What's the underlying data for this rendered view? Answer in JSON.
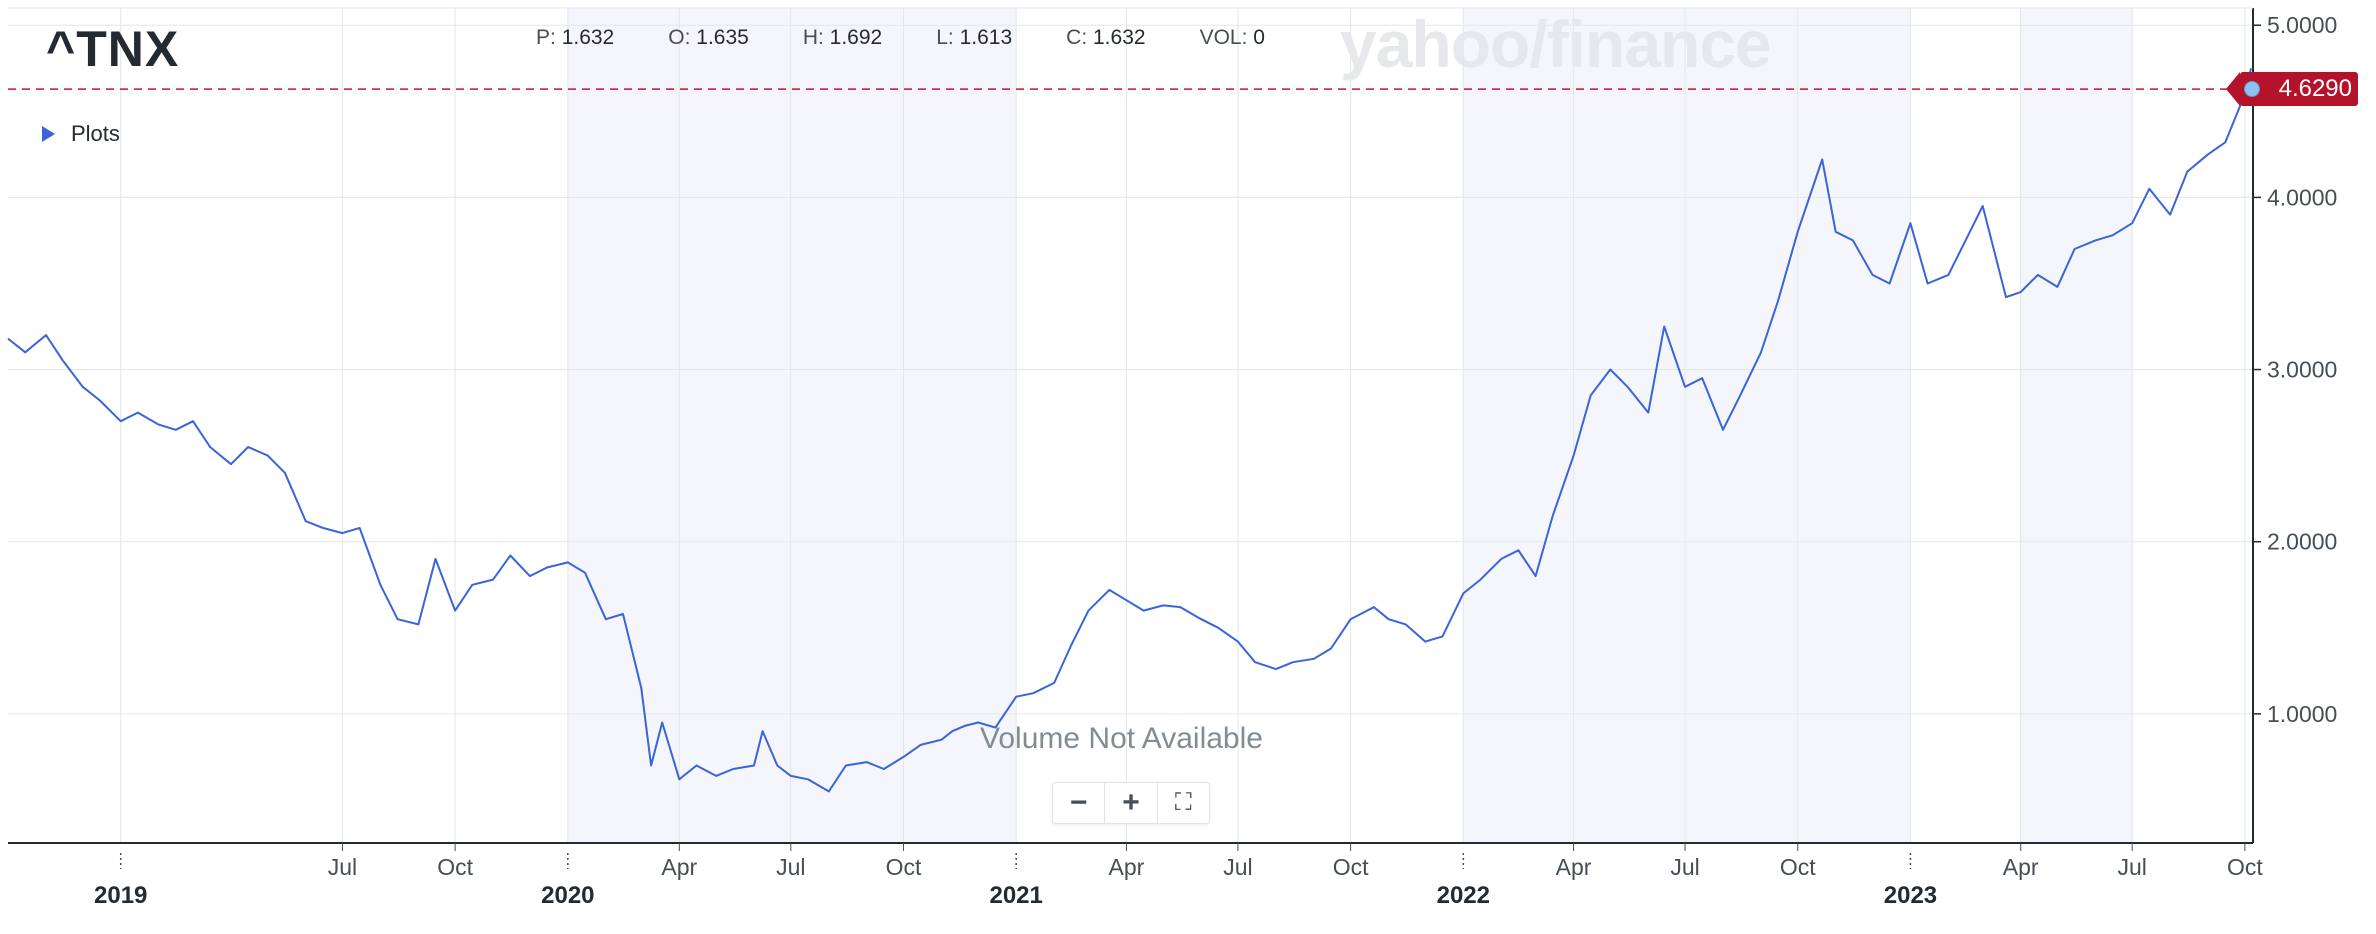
{
  "header": {
    "ticker": "^TNX",
    "ohlc": [
      {
        "key": "P:",
        "value": "1.632"
      },
      {
        "key": "O:",
        "value": "1.635"
      },
      {
        "key": "H:",
        "value": "1.692"
      },
      {
        "key": "L:",
        "value": "1.613"
      },
      {
        "key": "C:",
        "value": "1.632"
      },
      {
        "key": "VOL:",
        "value": "0"
      }
    ],
    "watermark": "yahoo/finance"
  },
  "plots_label": "Plots",
  "volume_note": "Volume Not Available",
  "zoom": {
    "minus": "−",
    "plus": "+",
    "fullscreen": "⛶"
  },
  "current_price": "4.6290",
  "colors": {
    "line": "#3a64d8",
    "price_tag": "#b4122a",
    "shade": "#f4f6fb",
    "grid": "#e3e6ea"
  },
  "chart_data": {
    "type": "line",
    "series": [
      {
        "x": [
          "2018-10-01",
          "2018-10-15",
          "2018-11-01",
          "2018-11-15",
          "2018-12-01",
          "2018-12-15",
          "2019-01-01",
          "2019-01-15",
          "2019-02-01",
          "2019-02-15",
          "2019-03-01",
          "2019-03-15",
          "2019-04-01",
          "2019-04-15",
          "2019-05-01",
          "2019-05-15",
          "2019-06-01",
          "2019-06-15",
          "2019-07-01",
          "2019-07-15",
          "2019-08-01",
          "2019-08-15",
          "2019-09-01",
          "2019-09-15",
          "2019-10-01",
          "2019-10-15",
          "2019-11-01",
          "2019-11-15",
          "2019-12-01",
          "2019-12-15",
          "2020-01-01",
          "2020-01-15",
          "2020-02-01",
          "2020-02-15",
          "2020-03-01",
          "2020-03-09",
          "2020-03-18",
          "2020-04-01",
          "2020-04-15",
          "2020-05-01",
          "2020-05-15",
          "2020-06-01",
          "2020-06-08",
          "2020-06-20",
          "2020-07-01",
          "2020-07-15",
          "2020-08-01",
          "2020-08-15",
          "2020-09-01",
          "2020-09-15",
          "2020-10-01",
          "2020-10-15",
          "2020-11-01",
          "2020-11-10",
          "2020-11-20",
          "2020-12-01",
          "2020-12-15",
          "2021-01-01",
          "2021-01-15",
          "2021-02-01",
          "2021-02-15",
          "2021-03-01",
          "2021-03-18",
          "2021-04-01",
          "2021-04-15",
          "2021-05-01",
          "2021-05-15",
          "2021-06-01",
          "2021-06-15",
          "2021-07-01",
          "2021-07-15",
          "2021-08-01",
          "2021-08-15",
          "2021-09-01",
          "2021-09-15",
          "2021-10-01",
          "2021-10-20",
          "2021-11-01",
          "2021-11-15",
          "2021-12-01",
          "2021-12-15",
          "2022-01-01",
          "2022-01-15",
          "2022-02-01",
          "2022-02-15",
          "2022-03-01",
          "2022-03-15",
          "2022-04-01",
          "2022-04-15",
          "2022-05-01",
          "2022-05-15",
          "2022-06-01",
          "2022-06-14",
          "2022-07-01",
          "2022-07-15",
          "2022-08-01",
          "2022-08-15",
          "2022-09-01",
          "2022-09-15",
          "2022-10-01",
          "2022-10-21",
          "2022-11-01",
          "2022-11-15",
          "2022-12-01",
          "2022-12-15",
          "2023-01-01",
          "2023-01-15",
          "2023-02-01",
          "2023-02-15",
          "2023-03-01",
          "2023-03-10",
          "2023-03-20",
          "2023-04-01",
          "2023-04-15",
          "2023-05-01",
          "2023-05-15",
          "2023-06-01",
          "2023-06-15",
          "2023-07-01",
          "2023-07-15",
          "2023-08-01",
          "2023-08-15",
          "2023-09-01",
          "2023-09-15",
          "2023-10-01",
          "2023-10-06"
        ],
        "y": [
          3.18,
          3.1,
          3.2,
          3.05,
          2.9,
          2.82,
          2.7,
          2.75,
          2.68,
          2.65,
          2.7,
          2.55,
          2.45,
          2.55,
          2.5,
          2.4,
          2.12,
          2.08,
          2.05,
          2.08,
          1.75,
          1.55,
          1.52,
          1.9,
          1.6,
          1.75,
          1.78,
          1.92,
          1.8,
          1.85,
          1.88,
          1.82,
          1.55,
          1.58,
          1.15,
          0.7,
          0.95,
          0.62,
          0.7,
          0.64,
          0.68,
          0.7,
          0.9,
          0.7,
          0.64,
          0.62,
          0.55,
          0.7,
          0.72,
          0.68,
          0.75,
          0.82,
          0.85,
          0.9,
          0.93,
          0.95,
          0.92,
          1.1,
          1.12,
          1.18,
          1.4,
          1.6,
          1.72,
          1.66,
          1.6,
          1.63,
          1.62,
          1.55,
          1.5,
          1.42,
          1.3,
          1.26,
          1.3,
          1.32,
          1.38,
          1.55,
          1.62,
          1.55,
          1.52,
          1.42,
          1.45,
          1.7,
          1.78,
          1.9,
          1.95,
          1.8,
          2.15,
          2.5,
          2.85,
          3.0,
          2.9,
          2.75,
          3.25,
          2.9,
          2.95,
          2.65,
          2.85,
          3.1,
          3.4,
          3.8,
          4.22,
          3.8,
          3.75,
          3.55,
          3.5,
          3.85,
          3.5,
          3.55,
          3.75,
          3.95,
          3.7,
          3.42,
          3.45,
          3.55,
          3.48,
          3.7,
          3.75,
          3.78,
          3.85,
          4.05,
          3.9,
          4.15,
          4.25,
          4.32,
          4.6,
          4.75
        ],
        "name": ""
      }
    ],
    "xlabel": "",
    "ylabel": "",
    "x_tick_labels": [
      "2019",
      "Jul",
      "Oct",
      "2020",
      "Apr",
      "Jul",
      "Oct",
      "2021",
      "Apr",
      "Jul",
      "Oct",
      "2022",
      "Apr",
      "Jul",
      "Oct",
      "2023",
      "Apr",
      "Jul",
      "Oct"
    ],
    "x_tick_dates": [
      "2019-01-01",
      "2019-07-01",
      "2019-10-01",
      "2020-01-01",
      "2020-04-01",
      "2020-07-01",
      "2020-10-01",
      "2021-01-01",
      "2021-04-01",
      "2021-07-01",
      "2021-10-01",
      "2022-01-01",
      "2022-04-01",
      "2022-07-01",
      "2022-10-01",
      "2023-01-01",
      "2023-04-01",
      "2023-07-01",
      "2023-10-01"
    ],
    "y_tick_labels": [
      "1.0000",
      "2.0000",
      "3.0000",
      "4.0000",
      "5.0000"
    ],
    "y_ticks": [
      1,
      2,
      3,
      4,
      5
    ],
    "ylim": [
      0.25,
      5.1
    ],
    "xlim": [
      "2018-10-01",
      "2023-10-06"
    ],
    "current_value": 4.629,
    "grid": true,
    "shaded_years": [
      "2020",
      "2022"
    ],
    "extra_shade": [
      "2023-04-01",
      "2023-07-01"
    ]
  }
}
